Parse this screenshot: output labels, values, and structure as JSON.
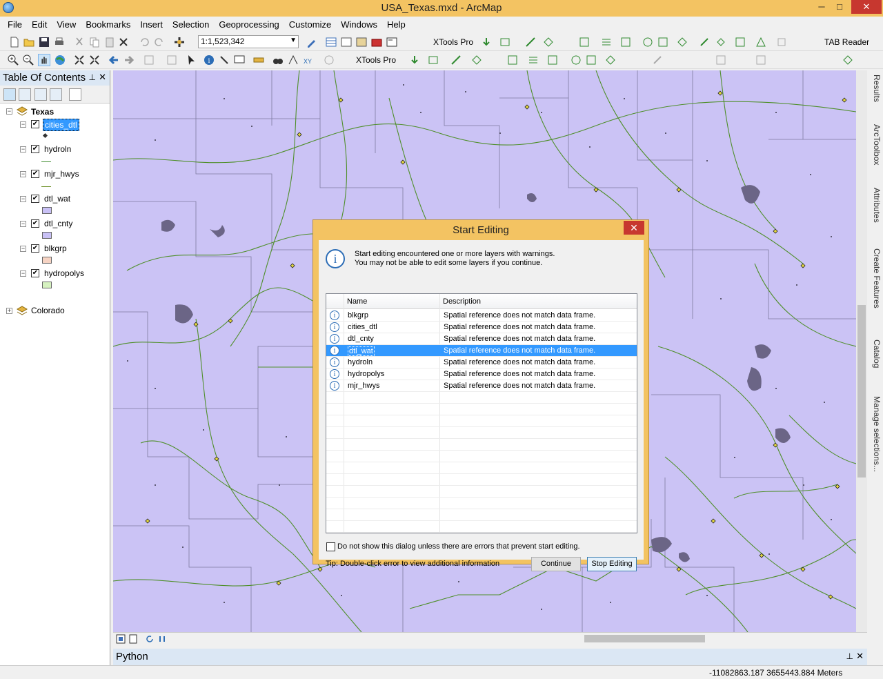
{
  "window": {
    "title": "USA_Texas.mxd - ArcMap",
    "min": "─",
    "max": "□",
    "close": "✕"
  },
  "menu": [
    "File",
    "Edit",
    "View",
    "Bookmarks",
    "Insert",
    "Selection",
    "Geoprocessing",
    "Customize",
    "Windows",
    "Help"
  ],
  "toolbar": {
    "scale": "1:1,523,342",
    "xtools1": "XTools Pro",
    "xtools2": "XTools Pro",
    "tabreader": "TAB Reader"
  },
  "toc": {
    "title": "Table Of Contents",
    "pin": "⊥",
    "close": "✕",
    "groups": [
      {
        "name": "Texas",
        "expanded": true
      },
      {
        "name": "Colorado",
        "expanded": false
      }
    ],
    "layers": [
      {
        "name": "cities_dtl",
        "checked": true,
        "symbol": "point",
        "selected": true
      },
      {
        "name": "hydroln",
        "checked": true,
        "symbol": "line",
        "color": "#3a8a2a"
      },
      {
        "name": "mjr_hwys",
        "checked": true,
        "symbol": "line",
        "color": "#6b8e23"
      },
      {
        "name": "dtl_wat",
        "checked": true,
        "symbol": "fill",
        "color": "#c9c1f6"
      },
      {
        "name": "dtl_cnty",
        "checked": true,
        "symbol": "fill",
        "color": "#c9c1f6"
      },
      {
        "name": "blkgrp",
        "checked": true,
        "symbol": "fill",
        "color": "#f6d3c3"
      },
      {
        "name": "hydropolys",
        "checked": true,
        "symbol": "fill",
        "color": "#d6f2c0"
      }
    ]
  },
  "dialog": {
    "title": "Start Editing",
    "close": "✕",
    "message_line1": "Start editing encountered one or more layers with warnings.",
    "message_line2": "You may not be able to edit some layers if you continue.",
    "col_name": "Name",
    "col_description": "Description",
    "rows": [
      {
        "name": "blkgrp",
        "description": "Spatial reference does not match data frame."
      },
      {
        "name": "cities_dtl",
        "description": "Spatial reference does not match data frame."
      },
      {
        "name": "dtl_cnty",
        "description": "Spatial reference does not match data frame."
      },
      {
        "name": "dtl_wat",
        "description": "Spatial reference does not match data frame."
      },
      {
        "name": "hydroln",
        "description": "Spatial reference does not match data frame."
      },
      {
        "name": "hydropolys",
        "description": "Spatial reference does not match data frame."
      },
      {
        "name": "mjr_hwys",
        "description": "Spatial reference does not match data frame."
      }
    ],
    "selected_row": "dtl_wat",
    "checkbox_label": "Do not show this dialog unless there are errors that prevent start editing.",
    "tip": "Tip: Double-click error to view additional information",
    "continue_label": "Continue",
    "stop_label": "Stop Editing"
  },
  "right_dock": [
    "Results",
    "ArcToolbox",
    "Attributes",
    "Create Features",
    "Catalog",
    "Manage selections..."
  ],
  "python": {
    "title": "Python",
    "pin": "⊥",
    "close": "✕"
  },
  "status": {
    "coords": "-11082863.187  3655443.884 Meters"
  },
  "colors": {
    "map_bg": "#cbc3f5",
    "title_bar": "#f3c362",
    "selection": "#3399ff",
    "rivers": "#3a8a2a"
  }
}
